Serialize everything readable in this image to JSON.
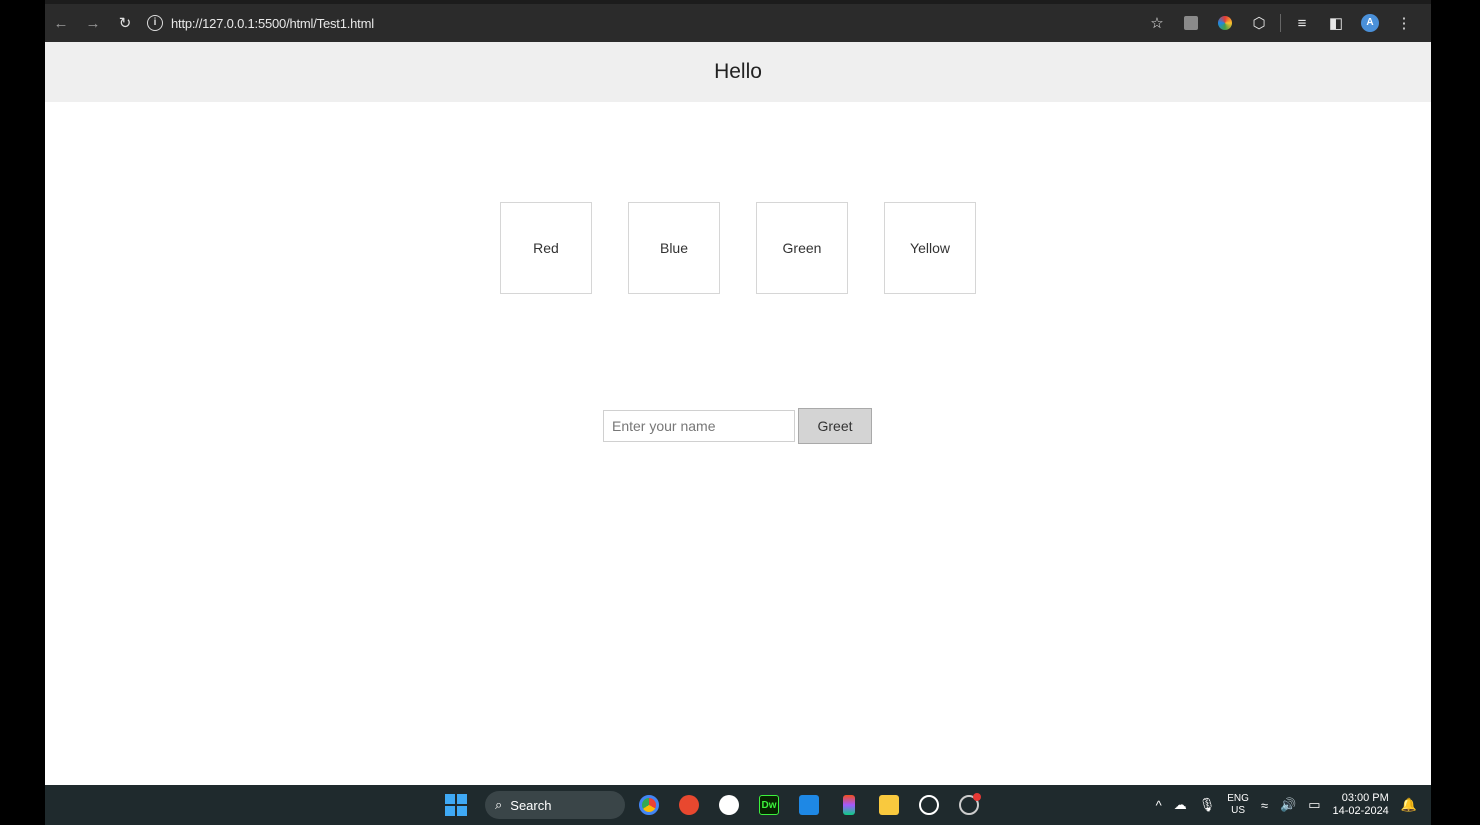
{
  "browser": {
    "url": "http://127.0.0.1:5500/html/Test1.html",
    "icons": {
      "back": "←",
      "forward": "→",
      "reload": "↻",
      "info": "i",
      "star": "☆",
      "puzzle": "⬡",
      "reading_list": "≡",
      "side_panel": "◧",
      "menu": "⋮"
    },
    "profile_initial": "A"
  },
  "page": {
    "header_title": "Hello",
    "boxes": [
      {
        "label": "Red"
      },
      {
        "label": "Blue"
      },
      {
        "label": "Green"
      },
      {
        "label": "Yellow"
      }
    ],
    "name_input": {
      "placeholder": "Enter your name",
      "value": ""
    },
    "greet_button": "Greet"
  },
  "taskbar": {
    "search_label": "Search",
    "search_icon": "⌕",
    "dw_label": "Dw",
    "tray": {
      "chevron": "^",
      "cloud": "☁",
      "mic": "🎙",
      "lang_top": "ENG",
      "lang_bottom": "US",
      "wifi": "≈",
      "volume": "🔊",
      "battery": "▭",
      "time": "03:00 PM",
      "date": "14-02-2024",
      "notification": "🔔"
    }
  },
  "colors": {
    "chrome_bg": "#2b2b2b",
    "header_bg": "#efefef",
    "taskbar_bg": "#1f2a2d",
    "accent_blue": "#4a90d9"
  }
}
